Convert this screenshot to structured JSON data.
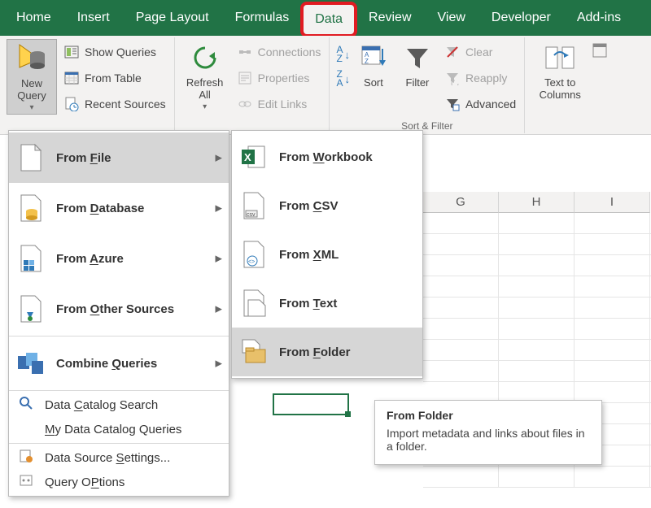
{
  "tabs": {
    "home": "Home",
    "insert": "Insert",
    "page_layout": "Page Layout",
    "formulas": "Formulas",
    "data": "Data",
    "review": "Review",
    "view": "View",
    "developer": "Developer",
    "addins": "Add-ins"
  },
  "ribbon": {
    "new_query": "New\nQuery",
    "show_queries": "Show Queries",
    "from_table": "From Table",
    "recent_sources": "Recent Sources",
    "refresh_all": "Refresh\nAll",
    "connections": "Connections",
    "properties": "Properties",
    "edit_links": "Edit Links",
    "sort": "Sort",
    "filter": "Filter",
    "clear": "Clear",
    "reapply": "Reapply",
    "advanced": "Advanced",
    "text_to_columns": "Text to\nColumns",
    "group_sort_filter": "Sort & Filter"
  },
  "menu1": {
    "from_file": "From File",
    "from_database": "From Database",
    "from_azure": "From Azure",
    "from_other_sources": "From Other Sources",
    "combine_queries": "Combine Queries",
    "data_catalog_search": "Data Catalog Search",
    "my_data_catalog_queries": "My Data Catalog Queries",
    "data_source_settings": "Data Source Settings...",
    "query_options": "Query Options"
  },
  "menu1_accel": {
    "from_file": "F",
    "from_database": "D",
    "from_azure": "A",
    "from_other_sources": "O",
    "combine_queries": "Q",
    "data_catalog_search": "C",
    "my_data_catalog_queries": "M",
    "data_source_settings": "S",
    "query_options": "P"
  },
  "menu2": {
    "from_workbook": "From Workbook",
    "from_csv": "From CSV",
    "from_xml": "From XML",
    "from_text": "From Text",
    "from_folder": "From Folder"
  },
  "menu2_accel": {
    "from_workbook": "W",
    "from_csv": "C",
    "from_xml": "X",
    "from_text": "T",
    "from_folder": "F"
  },
  "tooltip": {
    "title": "From Folder",
    "body": "Import metadata and links about files in a folder."
  },
  "columns": [
    "G",
    "H",
    "I"
  ]
}
